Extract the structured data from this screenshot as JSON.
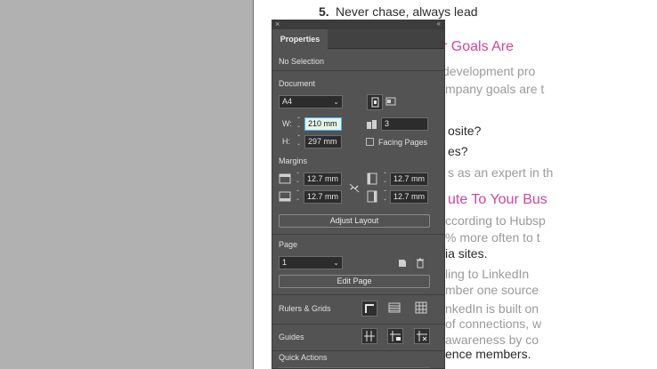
{
  "document_page": {
    "lines": [
      {
        "text": "5.",
        "style": "bold"
      },
      {
        "text": "Never chase, always lead",
        "style": "normal"
      },
      {
        "text": "r Goals Are",
        "style": "heading"
      },
      {
        "text": "development pro",
        "style": "faint"
      },
      {
        "text": "mpany goals are t",
        "style": "faint"
      },
      {
        "text": "osite?",
        "style": "normal"
      },
      {
        "text": "es?",
        "style": "normal"
      },
      {
        "text": "s as an expert in th",
        "style": "faint"
      },
      {
        "text": "ute To Your Bus",
        "style": "heading"
      },
      {
        "text": "ccording to Hubsp",
        "style": "faint"
      },
      {
        "text": "% more often to t",
        "style": "faint"
      },
      {
        "text": "ia sites.",
        "style": "normal"
      },
      {
        "text": "ling to LinkedIn",
        "style": "faint"
      },
      {
        "text": "mber one source",
        "style": "faint"
      },
      {
        "text": "nkedIn is built on",
        "style": "faint"
      },
      {
        "text": "of connections, w",
        "style": "faint"
      },
      {
        "text": "awareness by co",
        "style": "faint"
      },
      {
        "text": "ence members.",
        "style": "normal"
      }
    ]
  },
  "panel": {
    "close_glyph": "×",
    "collapse_glyph": "«",
    "tab_label": "Properties",
    "selection_status": "No Selection",
    "document": {
      "section_label": "Document",
      "page_size": "A4",
      "width_label": "W:",
      "width_value": "210 mm",
      "height_label": "H:",
      "height_value": "297 mm",
      "pages_value": "3",
      "facing_pages_label": "Facing Pages"
    },
    "margins": {
      "section_label": "Margins",
      "top": "12.7 mm",
      "bottom": "12.7 mm",
      "left": "12.7 mm",
      "right": "12.7 mm"
    },
    "adjust_layout_label": "Adjust Layout",
    "page": {
      "section_label": "Page",
      "current_page": "1",
      "edit_page_label": "Edit Page"
    },
    "rulers_grids_label": "Rulers & Grids",
    "guides_label": "Guides",
    "quick_actions_label": "Quick Actions"
  },
  "colors": {
    "panel_bg": "#535353",
    "heading_magenta": "#d0459a",
    "field_focus": "#49b8ff"
  }
}
